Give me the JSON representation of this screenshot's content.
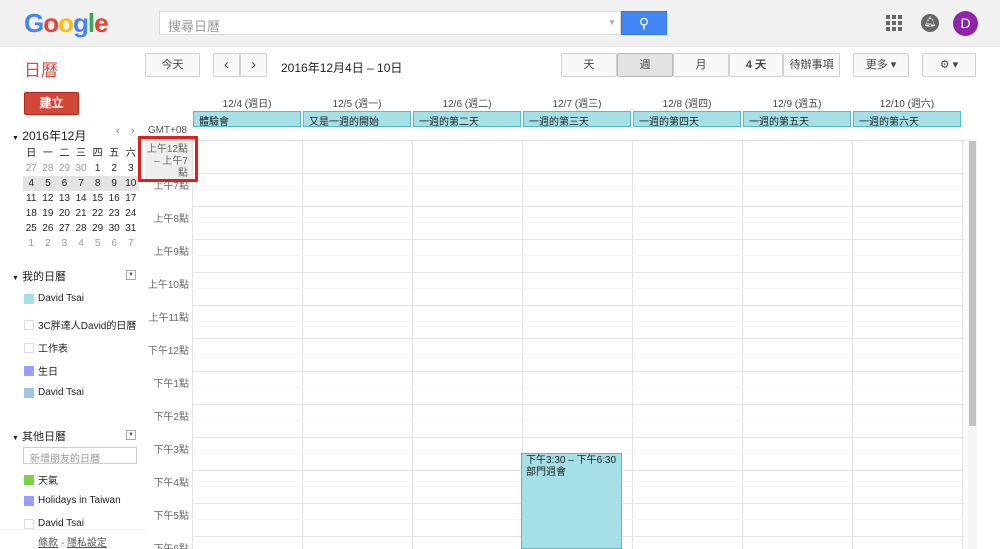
{
  "header": {
    "logo": "Google",
    "search_placeholder": "搜尋日曆",
    "avatar_letter": "D"
  },
  "toolbar": {
    "app_title": "日曆",
    "today": "今天",
    "prev": "‹",
    "next": "›",
    "date_range": "2016年12月4日 – 10日",
    "views": [
      "天",
      "週",
      "月",
      "4 天",
      "待辦事項"
    ],
    "selected_view": "週",
    "more": "更多 ▾",
    "settings": "⚙ ▾"
  },
  "sidebar": {
    "create": "建立",
    "mini_cal": {
      "title": "2016年12月",
      "weekdays": [
        "日",
        "一",
        "二",
        "三",
        "四",
        "五",
        "六"
      ],
      "weeks": [
        [
          "27",
          "28",
          "29",
          "30",
          "1",
          "2",
          "3"
        ],
        [
          "4",
          "5",
          "6",
          "7",
          "8",
          "9",
          "10"
        ],
        [
          "11",
          "12",
          "13",
          "14",
          "15",
          "16",
          "17"
        ],
        [
          "18",
          "19",
          "20",
          "21",
          "22",
          "23",
          "24"
        ],
        [
          "25",
          "26",
          "27",
          "28",
          "29",
          "30",
          "31"
        ],
        [
          "1",
          "2",
          "3",
          "4",
          "5",
          "6",
          "7"
        ]
      ]
    },
    "my_calendars": {
      "title": "我的日曆",
      "items": [
        {
          "label": "David Tsai",
          "color": "#a4e0e6"
        },
        {
          "label": "3C胖達人David的日曆",
          "color": "#ffffff"
        },
        {
          "label": "工作表",
          "color": "#ffffff"
        },
        {
          "label": "生日",
          "color": "#9a9cff"
        },
        {
          "label": "David Tsai",
          "color": "#9fc6e7"
        }
      ]
    },
    "other_calendars": {
      "title": "其他日曆",
      "add_placeholder": "新增朋友的日曆",
      "items": [
        {
          "label": "天氣",
          "color": "#7bd148"
        },
        {
          "label": "Holidays in Taiwan",
          "color": "#9a9cff"
        },
        {
          "label": "David Tsai",
          "color": "#ffffff"
        }
      ]
    },
    "footer": {
      "terms": "條款",
      "sep": " - ",
      "privacy": "隱私設定"
    }
  },
  "week": {
    "timezone": "GMT+08",
    "days": [
      "12/4 (週日)",
      "12/5 (週一)",
      "12/6 (週二)",
      "12/7 (週三)",
      "12/8 (週四)",
      "12/9 (週五)",
      "12/10 (週六)"
    ],
    "all_day": [
      "體驗會",
      "又是一週的開始",
      "一週的第二天",
      "一週的第三天",
      "一週的第四天",
      "一週的第五天",
      "一週的第六天"
    ],
    "collapsed_label": [
      "上午12點",
      "– 上午7點"
    ],
    "hours": [
      "上午7點",
      "上午8點",
      "上午9點",
      "上午10點",
      "上午11點",
      "下午12點",
      "下午1點",
      "下午2點",
      "下午3點",
      "下午4點",
      "下午5點",
      "下午6點"
    ],
    "event": {
      "time": "下午3:30 – 下午6:30",
      "title": "部門週會",
      "day": "12/7 (週三)"
    }
  }
}
